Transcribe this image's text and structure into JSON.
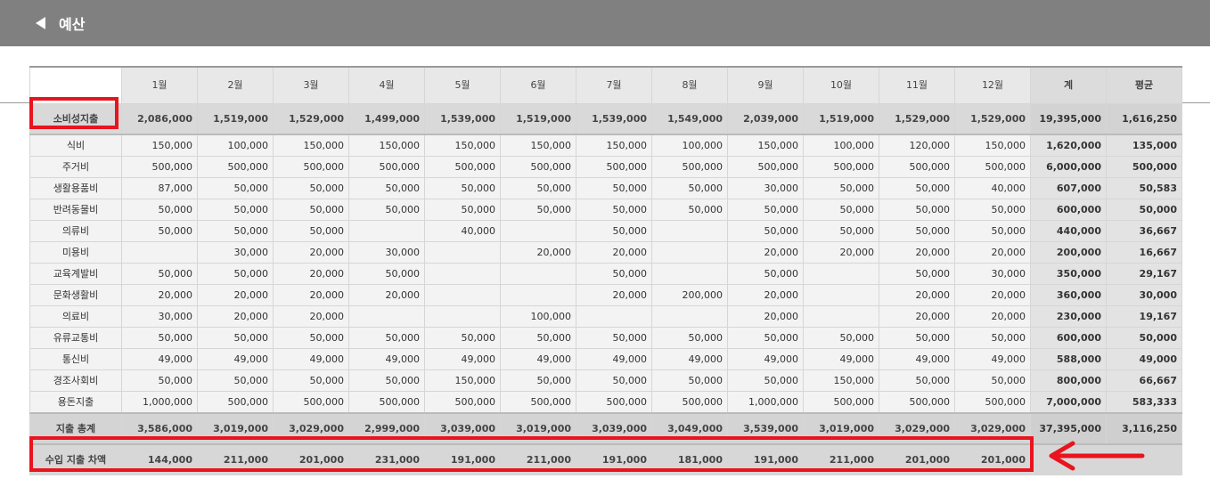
{
  "header": {
    "title": "예산",
    "back_icon": "left-triangle-icon"
  },
  "table": {
    "months": [
      "1월",
      "2월",
      "3월",
      "4월",
      "5월",
      "6월",
      "7월",
      "8월",
      "9월",
      "10월",
      "11월",
      "12월"
    ],
    "total_header": "계",
    "avg_header": "평균",
    "group": {
      "label": "소비성지출",
      "values": [
        "2,086,000",
        "1,519,000",
        "1,529,000",
        "1,499,000",
        "1,539,000",
        "1,519,000",
        "1,539,000",
        "1,549,000",
        "2,039,000",
        "1,519,000",
        "1,529,000",
        "1,529,000"
      ],
      "total": "19,395,000",
      "avg": "1,616,250"
    },
    "rows": [
      {
        "label": "식비",
        "values": [
          "150,000",
          "100,000",
          "150,000",
          "150,000",
          "150,000",
          "150,000",
          "150,000",
          "100,000",
          "150,000",
          "100,000",
          "120,000",
          "150,000"
        ],
        "total": "1,620,000",
        "avg": "135,000"
      },
      {
        "label": "주거비",
        "values": [
          "500,000",
          "500,000",
          "500,000",
          "500,000",
          "500,000",
          "500,000",
          "500,000",
          "500,000",
          "500,000",
          "500,000",
          "500,000",
          "500,000"
        ],
        "total": "6,000,000",
        "avg": "500,000"
      },
      {
        "label": "생활용품비",
        "values": [
          "87,000",
          "50,000",
          "50,000",
          "50,000",
          "50,000",
          "50,000",
          "50,000",
          "50,000",
          "30,000",
          "50,000",
          "50,000",
          "40,000"
        ],
        "total": "607,000",
        "avg": "50,583"
      },
      {
        "label": "반려동물비",
        "values": [
          "50,000",
          "50,000",
          "50,000",
          "50,000",
          "50,000",
          "50,000",
          "50,000",
          "50,000",
          "50,000",
          "50,000",
          "50,000",
          "50,000"
        ],
        "total": "600,000",
        "avg": "50,000"
      },
      {
        "label": "의류비",
        "values": [
          "50,000",
          "50,000",
          "50,000",
          "",
          "40,000",
          "",
          "50,000",
          "",
          "50,000",
          "50,000",
          "50,000",
          "50,000"
        ],
        "total": "440,000",
        "avg": "36,667"
      },
      {
        "label": "미용비",
        "values": [
          "",
          "30,000",
          "20,000",
          "30,000",
          "",
          "20,000",
          "20,000",
          "",
          "20,000",
          "20,000",
          "20,000",
          "20,000"
        ],
        "total": "200,000",
        "avg": "16,667"
      },
      {
        "label": "교육계발비",
        "values": [
          "50,000",
          "50,000",
          "20,000",
          "50,000",
          "",
          "",
          "50,000",
          "",
          "50,000",
          "",
          "50,000",
          "30,000"
        ],
        "total": "350,000",
        "avg": "29,167"
      },
      {
        "label": "문화생활비",
        "values": [
          "20,000",
          "20,000",
          "20,000",
          "20,000",
          "",
          "",
          "20,000",
          "200,000",
          "20,000",
          "",
          "20,000",
          "20,000"
        ],
        "total": "360,000",
        "avg": "30,000"
      },
      {
        "label": "의료비",
        "values": [
          "30,000",
          "20,000",
          "20,000",
          "",
          "",
          "100,000",
          "",
          "",
          "20,000",
          "",
          "20,000",
          "20,000"
        ],
        "total": "230,000",
        "avg": "19,167"
      },
      {
        "label": "유류교통비",
        "values": [
          "50,000",
          "50,000",
          "50,000",
          "50,000",
          "50,000",
          "50,000",
          "50,000",
          "50,000",
          "50,000",
          "50,000",
          "50,000",
          "50,000"
        ],
        "total": "600,000",
        "avg": "50,000"
      },
      {
        "label": "통신비",
        "values": [
          "49,000",
          "49,000",
          "49,000",
          "49,000",
          "49,000",
          "49,000",
          "49,000",
          "49,000",
          "49,000",
          "49,000",
          "49,000",
          "49,000"
        ],
        "total": "588,000",
        "avg": "49,000"
      },
      {
        "label": "경조사회비",
        "values": [
          "50,000",
          "50,000",
          "50,000",
          "50,000",
          "150,000",
          "50,000",
          "50,000",
          "50,000",
          "50,000",
          "150,000",
          "50,000",
          "50,000"
        ],
        "total": "800,000",
        "avg": "66,667"
      },
      {
        "label": "용돈지출",
        "values": [
          "1,000,000",
          "500,000",
          "500,000",
          "500,000",
          "500,000",
          "500,000",
          "500,000",
          "500,000",
          "1,000,000",
          "500,000",
          "500,000",
          "500,000"
        ],
        "total": "7,000,000",
        "avg": "583,333"
      }
    ],
    "total_row": {
      "label": "지출 총계",
      "values": [
        "3,586,000",
        "3,019,000",
        "3,029,000",
        "2,999,000",
        "3,039,000",
        "3,019,000",
        "3,039,000",
        "3,049,000",
        "3,539,000",
        "3,019,000",
        "3,029,000",
        "3,029,000"
      ],
      "total": "37,395,000",
      "avg": "3,116,250"
    },
    "diff_row": {
      "label": "수입 지출 차액",
      "values": [
        "144,000",
        "211,000",
        "201,000",
        "231,000",
        "191,000",
        "211,000",
        "191,000",
        "181,000",
        "191,000",
        "211,000",
        "201,000",
        "201,000"
      ]
    }
  },
  "colors": {
    "header_bg": "#808080",
    "annotation_red": "#e8141e"
  }
}
